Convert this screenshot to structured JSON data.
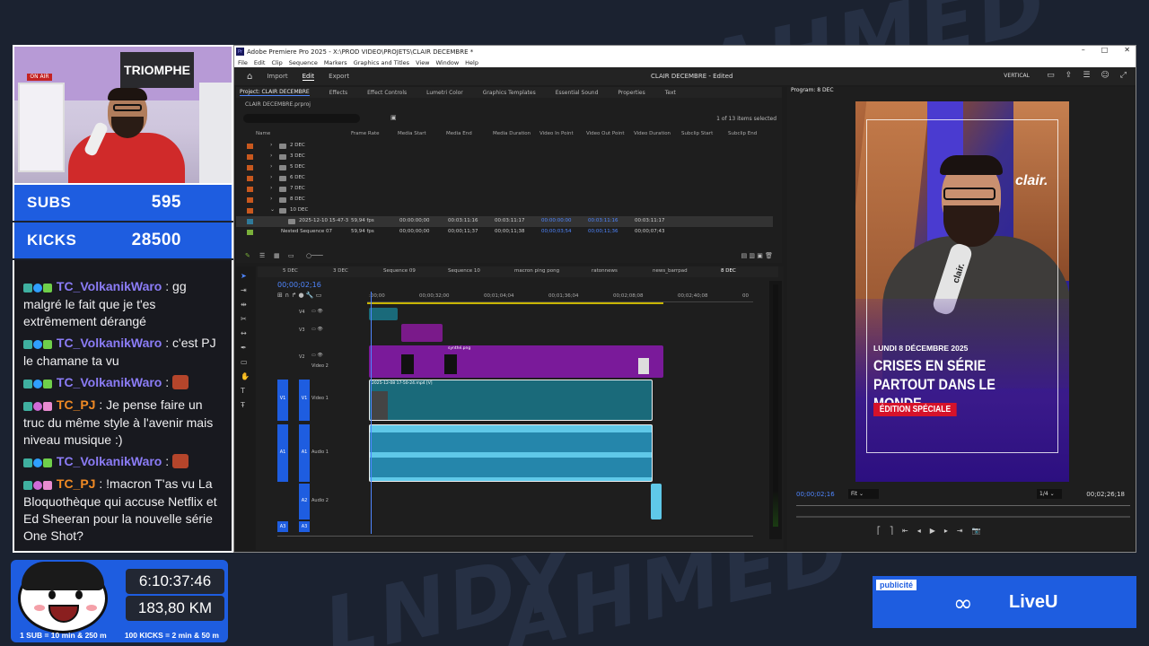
{
  "background": {
    "words": [
      "AHMED",
      "LNDY"
    ]
  },
  "webcam": {
    "sign": "TRIOMPHE",
    "onair": "ON AIR"
  },
  "counters": {
    "subs_label": "SUBS",
    "subs_value": "595",
    "kicks_label": "KICKS",
    "kicks_value": "28500"
  },
  "chat": {
    "messages": [
      {
        "user": "TC_VolkanikWaro",
        "user_color": "#8b7cf6",
        "text": "gg malgré le fait que je t'es extrêmement dérangé"
      },
      {
        "user": "TC_VolkanikWaro",
        "user_color": "#8b7cf6",
        "text": "c'est PJ le chamane ta vu"
      },
      {
        "user": "TC_VolkanikWaro",
        "user_color": "#8b7cf6",
        "text": ""
      },
      {
        "user": "TC_PJ",
        "user_color": "#f08a24",
        "text": "Je pense faire un truc du même style à l'avenir mais niveau musique :)"
      },
      {
        "user": "TC_VolkanikWaro",
        "user_color": "#8b7cf6",
        "text": ""
      },
      {
        "user": "TC_PJ",
        "user_color": "#f08a24",
        "text": "!macron T'as vu La Bloquothèque qui accuse Netflix et Ed Sheeran pour la nouvelle série One Shot?"
      }
    ]
  },
  "stats": {
    "timer": "6:10:37:46",
    "distance": "183,80 KM",
    "rule_subs": "1 SUB = 10 min & 250 m",
    "rule_kicks": "100 KICKS = 2 min & 50 m"
  },
  "ad": {
    "tag": "publicité",
    "brand": "LiveU"
  },
  "premiere": {
    "title": "Adobe Premiere Pro 2025 - X:\\PROD VIDEO\\PROJETS\\CLAIR DECEMBRE *",
    "menu": [
      "File",
      "Edit",
      "Clip",
      "Sequence",
      "Markers",
      "Graphics and Titles",
      "View",
      "Window",
      "Help"
    ],
    "modes": [
      "Import",
      "Edit",
      "Export"
    ],
    "project_name": "CLAIR DECEMBRE - Edited",
    "layout_label": "VERTICAL",
    "panel_tabs": [
      "Project: CLAIR DECEMBRE",
      "Effects",
      "Effect Controls",
      "Lumetri Color",
      "Graphics Templates",
      "Essential Sound",
      "Properties",
      "Text"
    ],
    "project_file": "CLAIR DECEMBRE.prproj",
    "items_selected": "1 of 13 items selected",
    "columns": [
      "Name",
      "Frame Rate",
      "Media Start",
      "Media End",
      "Media Duration",
      "Video In Point",
      "Video Out Point",
      "Video Duration",
      "Subclip Start",
      "Subclip End"
    ],
    "folders": [
      {
        "name": "2 DEC",
        "color": "#c8581e"
      },
      {
        "name": "3 DEC",
        "color": "#c8581e"
      },
      {
        "name": "5 DEC",
        "color": "#c8581e"
      },
      {
        "name": "6 DEC",
        "color": "#c8581e"
      },
      {
        "name": "7 DEC",
        "color": "#c8581e"
      },
      {
        "name": "8 DEC",
        "color": "#c8581e"
      },
      {
        "name": "10 DEC",
        "color": "#c8581e"
      }
    ],
    "clip_row": {
      "name": "2025-12-10 15-47-3",
      "fps": "59,94 fps",
      "mstart": "00:00:00;00",
      "mend": "00:03:11:16",
      "mdur": "00:03:11:17",
      "vin": "00:00:00:00",
      "vout": "00:03:11:16",
      "vdur": "00:03:11:17",
      "swatch": "#2f7a9a"
    },
    "nested_row": {
      "name": "Nested Sequence 07",
      "fps": "59,94 fps",
      "mstart": "00;00;00;00",
      "mend": "00;00;11;37",
      "mdur": "00;00;11;38",
      "vin": "00;00;03;54",
      "vout": "00;00;11;36",
      "vdur": "00;00;07;43",
      "swatch": "#7ab03a"
    },
    "seq_tabs": [
      "5 DEC",
      "3 DEC",
      "Sequence 09",
      "Sequence 10",
      "macron ping pong",
      "ratonnews",
      "news_barrpad",
      "8 DEC"
    ],
    "timecode": "00;00;02;16",
    "ruler": [
      ":00;00",
      "00;00;32;00",
      "00;01;04;04",
      "00;01;36;04",
      "00;02;08;08",
      "00;02;40;08",
      "00"
    ],
    "tracks": {
      "v4": "V4",
      "v3": "V3",
      "v2": "V2",
      "v2_name": "Video 2",
      "v1": "V1",
      "v1_name": "Video 1",
      "a1": "A1",
      "a1_name": "Audio 1",
      "a2": "A2",
      "a2_name": "Audio 2",
      "a3": "A3"
    },
    "clip_v1_label": "2025-12-08 17-50-24.mp4 [V]",
    "clip_v2_label": "synthé.png",
    "program_tab": "Program: 8 DEC",
    "program_time": "00;00;02;16",
    "program_fit": "Fit",
    "program_quality": "1/4",
    "program_duration": "00;02;26;18",
    "video": {
      "logo": "clair.",
      "mic_label": "clair.",
      "date": "LUNDI 8 DÉCEMBRE 2025",
      "title_line1": "CRISES EN SÉRIE",
      "title_line2": "PARTOUT DANS LE MONDE",
      "badge": "ÉDITION SPÉCIALE"
    }
  }
}
